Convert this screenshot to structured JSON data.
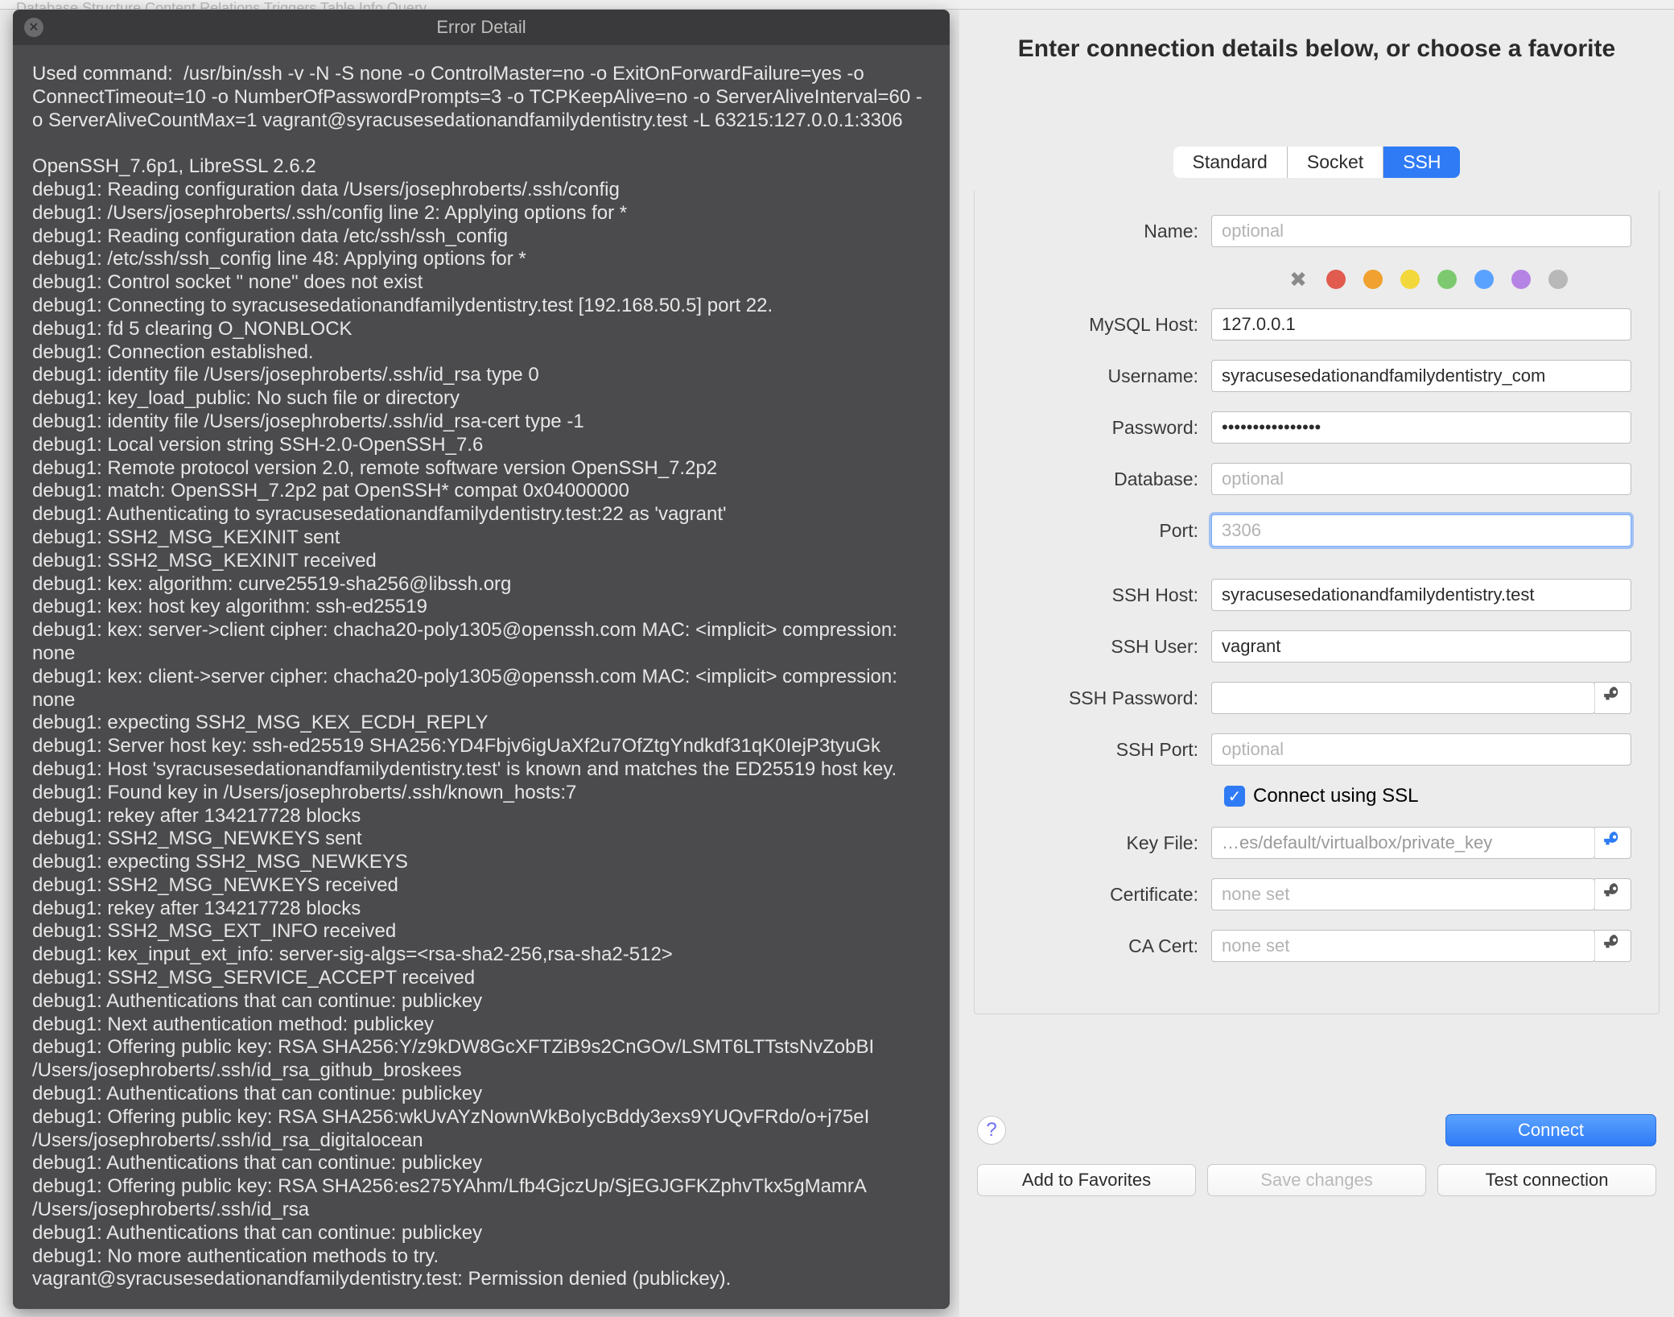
{
  "toolbar_faded": "Database    Structure   Content   Relations   Triggers   Table Info   Query",
  "error": {
    "title": "Error Detail",
    "body": "Used command:  /usr/bin/ssh -v -N -S none -o ControlMaster=no -o ExitOnForwardFailure=yes -o ConnectTimeout=10 -o NumberOfPasswordPrompts=3 -o TCPKeepAlive=no -o ServerAliveInterval=60 -o ServerAliveCountMax=1 vagrant@syracusesedationandfamilydentistry.test -L 63215:127.0.0.1:3306\n\nOpenSSH_7.6p1, LibreSSL 2.6.2\ndebug1: Reading configuration data /Users/josephroberts/.ssh/config\ndebug1: /Users/josephroberts/.ssh/config line 2: Applying options for *\ndebug1: Reading configuration data /etc/ssh/ssh_config\ndebug1: /etc/ssh/ssh_config line 48: Applying options for *\ndebug1: Control socket \" none\" does not exist\ndebug1: Connecting to syracusesedationandfamilydentistry.test [192.168.50.5] port 22.\ndebug1: fd 5 clearing O_NONBLOCK\ndebug1: Connection established.\ndebug1: identity file /Users/josephroberts/.ssh/id_rsa type 0\ndebug1: key_load_public: No such file or directory\ndebug1: identity file /Users/josephroberts/.ssh/id_rsa-cert type -1\ndebug1: Local version string SSH-2.0-OpenSSH_7.6\ndebug1: Remote protocol version 2.0, remote software version OpenSSH_7.2p2\ndebug1: match: OpenSSH_7.2p2 pat OpenSSH* compat 0x04000000\ndebug1: Authenticating to syracusesedationandfamilydentistry.test:22 as 'vagrant'\ndebug1: SSH2_MSG_KEXINIT sent\ndebug1: SSH2_MSG_KEXINIT received\ndebug1: kex: algorithm: curve25519-sha256@libssh.org\ndebug1: kex: host key algorithm: ssh-ed25519\ndebug1: kex: server->client cipher: chacha20-poly1305@openssh.com MAC: <implicit> compression: none\ndebug1: kex: client->server cipher: chacha20-poly1305@openssh.com MAC: <implicit> compression: none\ndebug1: expecting SSH2_MSG_KEX_ECDH_REPLY\ndebug1: Server host key: ssh-ed25519 SHA256:YD4Fbjv6igUaXf2u7OfZtgYndkdf31qK0IejP3tyuGk\ndebug1: Host 'syracusesedationandfamilydentistry.test' is known and matches the ED25519 host key.\ndebug1: Found key in /Users/josephroberts/.ssh/known_hosts:7\ndebug1: rekey after 134217728 blocks\ndebug1: SSH2_MSG_NEWKEYS sent\ndebug1: expecting SSH2_MSG_NEWKEYS\ndebug1: SSH2_MSG_NEWKEYS received\ndebug1: rekey after 134217728 blocks\ndebug1: SSH2_MSG_EXT_INFO received\ndebug1: kex_input_ext_info: server-sig-algs=<rsa-sha2-256,rsa-sha2-512>\ndebug1: SSH2_MSG_SERVICE_ACCEPT received\ndebug1: Authentications that can continue: publickey\ndebug1: Next authentication method: publickey\ndebug1: Offering public key: RSA SHA256:Y/z9kDW8GcXFTZiB9s2CnGOv/LSMT6LTTstsNvZobBI /Users/josephroberts/.ssh/id_rsa_github_broskees\ndebug1: Authentications that can continue: publickey\ndebug1: Offering public key: RSA SHA256:wkUvAYzNownWkBoIycBddy3exs9YUQvFRdo/o+j75eI /Users/josephroberts/.ssh/id_rsa_digitalocean\ndebug1: Authentications that can continue: publickey\ndebug1: Offering public key: RSA SHA256:es275YAhm/Lfb4GjczUp/SjEGJGFKZphvTkx5gMamrA /Users/josephroberts/.ssh/id_rsa\ndebug1: Authentications that can continue: publickey\ndebug1: No more authentication methods to try.\nvagrant@syracusesedationandfamilydentistry.test: Permission denied (publickey)."
  },
  "conn": {
    "heading": "Enter connection details below, or choose a favorite",
    "tabs": {
      "standard": "Standard",
      "socket": "Socket",
      "ssh": "SSH"
    },
    "labels": {
      "name": "Name:",
      "mysql_host": "MySQL Host:",
      "username": "Username:",
      "password": "Password:",
      "database": "Database:",
      "port": "Port:",
      "ssh_host": "SSH Host:",
      "ssh_user": "SSH User:",
      "ssh_password": "SSH Password:",
      "ssh_port": "SSH Port:",
      "use_ssl": "Connect using SSL",
      "key_file": "Key File:",
      "certificate": "Certificate:",
      "ca_cert": "CA Cert:"
    },
    "placeholders": {
      "name": "optional",
      "database": "optional",
      "port": "3306",
      "ssh_port": "optional",
      "certificate": "none set",
      "ca_cert": "none set"
    },
    "values": {
      "name": "",
      "mysql_host": "127.0.0.1",
      "username": "syracusesedationandfamilydentistry_com",
      "password": "••••••••••••••••",
      "database": "",
      "port": "",
      "ssh_host": "syracusesedationandfamilydentistry.test",
      "ssh_user": "vagrant",
      "ssh_password": "",
      "ssh_port": "",
      "key_file": "…es/default/virtualbox/private_key",
      "certificate": "",
      "ca_cert": ""
    },
    "use_ssl_checked": true,
    "colors": [
      "#e15b4e",
      "#f0a12f",
      "#f2d83b",
      "#7cc96f",
      "#5aa2ff",
      "#b583e3",
      "#b8b8b8"
    ],
    "buttons": {
      "connect": "Connect",
      "add_fav": "Add to Favorites",
      "save": "Save changes",
      "test": "Test connection"
    }
  }
}
